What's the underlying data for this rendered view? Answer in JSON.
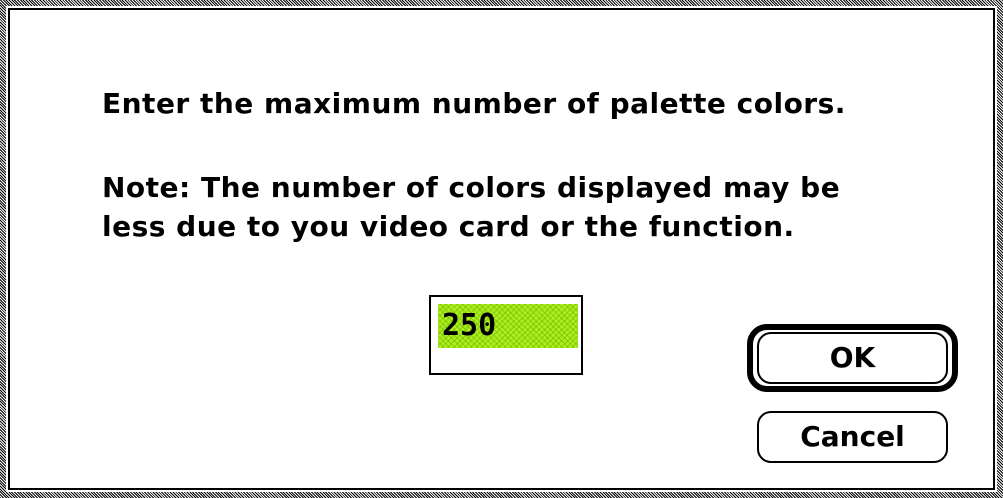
{
  "dialog": {
    "message_line1": "Enter the maximum number of palette colors.",
    "note_line1": "Note:  The number of colors displayed may be",
    "note_line2": "less due to you video card or the function.",
    "max_colors_value": "250",
    "ok_label": "OK",
    "cancel_label": "Cancel"
  },
  "colors": {
    "selection_highlight": "#a9f11a",
    "frame": "#000000",
    "background": "#ffffff"
  }
}
